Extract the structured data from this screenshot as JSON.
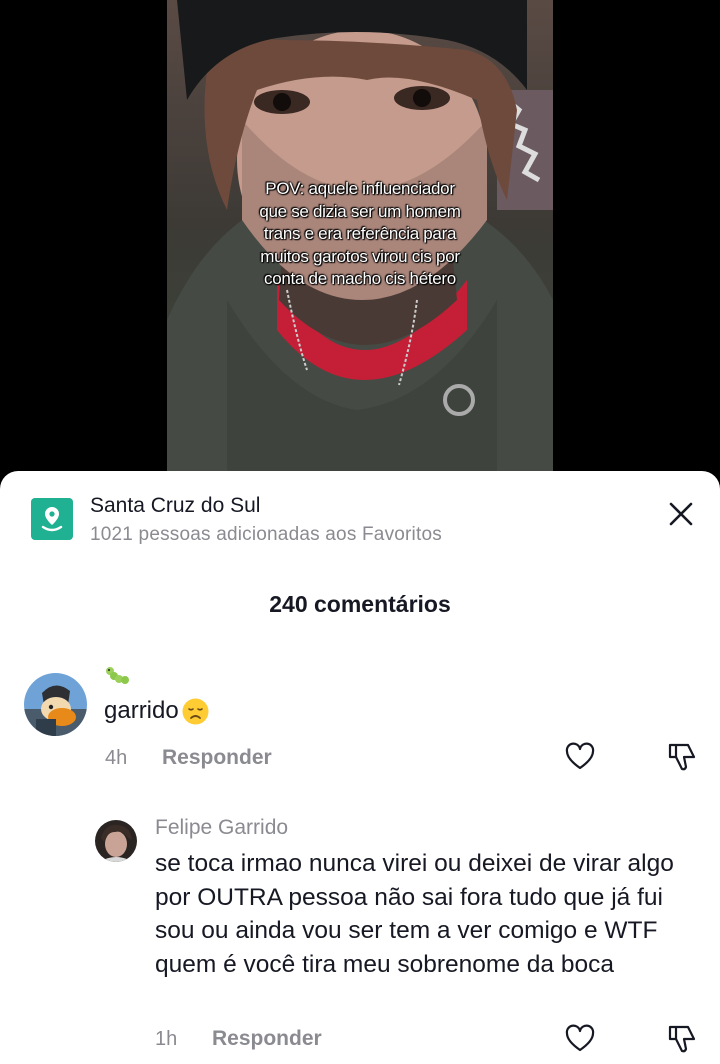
{
  "video": {
    "caption": "POV: aquele influenciador\nque se dizia ser um homem\ntrans e era referência para\nmuitos garotos virou cis por\nconta de macho cis hétero"
  },
  "sheet": {
    "place_title": "Santa Cruz do Sul",
    "place_subtitle": "1021 pessoas adicionadas aos Favoritos",
    "place_icon": "location-pin-icon",
    "close_icon": "close-icon",
    "comment_count_label": "240 comentários"
  },
  "comments": [
    {
      "badge": "🐛",
      "text": "garrido",
      "emoji": "disappointed-face",
      "time": "4h",
      "reply_label": "Responder"
    }
  ],
  "replies": [
    {
      "author": "Felipe Garrido",
      "text": "se toca irmao nunca virei ou deixei de virar algo por OUTRA pessoa não sai fora tudo que já fui sou ou ainda vou ser tem a ver comigo e WTF quem é você tira meu sobrenome da boca",
      "time": "1h",
      "reply_label": "Responder"
    }
  ],
  "colors": {
    "place_icon_bg": "#1fb191",
    "muted_text": "#8a8b91",
    "primary_text": "#161823"
  }
}
